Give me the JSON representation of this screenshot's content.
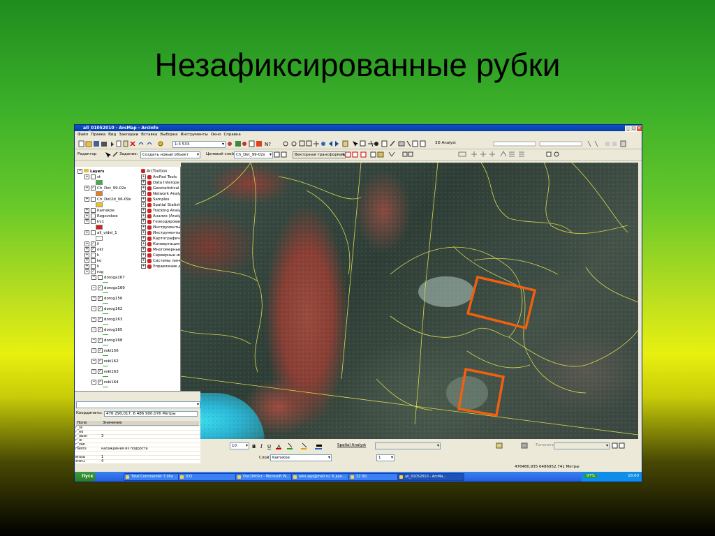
{
  "slide": {
    "title": "Незафиксированные рубки"
  },
  "window": {
    "title": "all_01052010 - ArcMap - ArcInfo",
    "menu": [
      "Файл",
      "Правка",
      "Вид",
      "Закладки",
      "Вставка",
      "Выборка",
      "Инструменты",
      "Окно",
      "Справка"
    ],
    "scale": "1:3 533",
    "editor_label": "Редактор",
    "task_label": "Задание:",
    "task_value": "Создать новый объект",
    "target_label": "Целевой слой:",
    "target_value": "Ch_Det_99-02s",
    "transform_value": "Векторная трансформация",
    "analyst_3d": "3D Analyst",
    "layer_label": "Слой:"
  },
  "toc": {
    "root": "Layers",
    "items": [
      {
        "label": "st",
        "checked": false,
        "sym": "#3cb33c"
      },
      {
        "label": "Ch_Det_99-02s",
        "checked": true,
        "sym": "#e67e22"
      },
      {
        "label": "Ch_Det2d_06-09s",
        "checked": false,
        "sym": "#f0c020"
      },
      {
        "label": "Kamskoe",
        "checked": false,
        "sym": ""
      },
      {
        "label": "Rogovskoe",
        "checked": false,
        "sym": ""
      },
      {
        "label": "kv1",
        "checked": false,
        "sym": "#d62020"
      },
      {
        "label": "all_videl_1",
        "checked": false,
        "sym": "#ffffff"
      },
      {
        "label": "il",
        "checked": true,
        "sym": ""
      },
      {
        "label": "okt",
        "checked": true,
        "sym": ""
      },
      {
        "label": "k",
        "checked": false,
        "sym": ""
      },
      {
        "label": "ko",
        "checked": false,
        "sym": ""
      },
      {
        "label": "k",
        "checked": false,
        "sym": ""
      },
      {
        "label": "rog",
        "checked": true,
        "sym": ""
      },
      {
        "label": "doroga167",
        "checked": false,
        "sym": ""
      },
      {
        "label": "doroga169",
        "checked": true,
        "sym": ""
      },
      {
        "label": "dorog156",
        "checked": true,
        "sym": ""
      },
      {
        "label": "dorog162",
        "checked": true,
        "sym": ""
      },
      {
        "label": "dorog163",
        "checked": true,
        "sym": ""
      },
      {
        "label": "dorog165",
        "checked": true,
        "sym": ""
      },
      {
        "label": "dorog168",
        "checked": true,
        "sym": ""
      },
      {
        "label": "reki156",
        "checked": true,
        "sym": ""
      },
      {
        "label": "reki162",
        "checked": true,
        "sym": ""
      },
      {
        "label": "reki163",
        "checked": true,
        "sym": ""
      },
      {
        "label": "reki164",
        "checked": true,
        "sym": ""
      }
    ]
  },
  "arctoolbox": {
    "root": "ArcToolbox",
    "items": [
      "ArcPad Tools",
      "Data Interope",
      "Geostatistical A",
      "Network Analy",
      "Samples",
      "Spatial Statisti",
      "Tracking Analy",
      "Анализ (Analy",
      "Геокодирован",
      "Инструменты",
      "Инструменты",
      "Картографиче",
      "Конвертация",
      "Многомерные",
      "Серверные ин",
      "Системы лине",
      "Управление д"
    ]
  },
  "attributes": {
    "coord_label": "Координаты:",
    "coord_value": "476 290,017. 6 486 900,076 Метры",
    "col_name": "Поле",
    "col_value": "Значение",
    "rows": [
      {
        "k": "г_re",
        "v": "<null>"
      },
      {
        "k": "г_ed",
        "v": "<null>"
      },
      {
        "k": "г_obsh",
        "v": "3"
      },
      {
        "k": "г_lk",
        "v": "<null>"
      },
      {
        "k": "г_zan",
        "v": "<null>"
      },
      {
        "k": "ments",
        "v": "насаждения из подроста"
      },
      {
        "k": "",
        "v": "<null>"
      },
      {
        "k": "вrusa",
        "v": "1"
      },
      {
        "k": "shet1",
        "v": "4"
      }
    ]
  },
  "draw_toolbar": {
    "font_size": "10",
    "spatial_analyst": "Spatial Analyst",
    "topology": "Топология"
  },
  "layer_toolbar": {
    "layer_value": "Kamskoe",
    "value": "1"
  },
  "statusbar": {
    "coords": "476480,935  6486952,741 Метры"
  },
  "taskbar": {
    "start": "Пуск",
    "tasks": [
      "Total Commander 7.0ha ...",
      "ICQ",
      "Doc1PrtScr - Microsoft W...",
      "alex.ago@mail.ru: К дон...",
      "22 IDL",
      "all_01052010 - ArcMa..."
    ],
    "battery": "97%",
    "time": "18:00"
  },
  "colors": {
    "cut_box": "#f06010",
    "boundary": "#d8d850"
  }
}
